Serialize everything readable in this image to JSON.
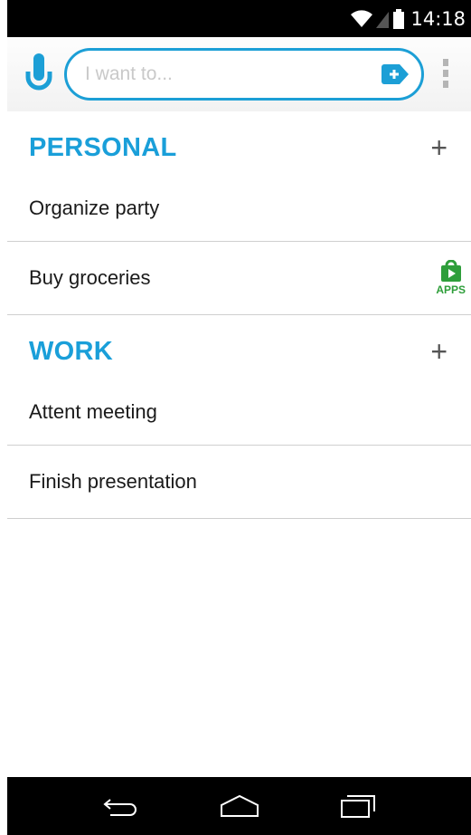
{
  "status_bar": {
    "time": "14:18"
  },
  "header": {
    "search_placeholder": "I want to...",
    "accent_color": "#1c9fd6",
    "icons": {
      "mic": "mic-icon",
      "add_tag": "add-tag-icon",
      "overflow": "overflow-menu-icon"
    }
  },
  "sections": [
    {
      "title": "PERSONAL",
      "add_label": "+",
      "tasks": [
        {
          "label": "Organize party"
        },
        {
          "label": "Buy groceries",
          "badge": "APPS"
        }
      ]
    },
    {
      "title": "WORK",
      "add_label": "+",
      "tasks": [
        {
          "label": "Attent meeting"
        },
        {
          "label": "Finish presentation"
        }
      ]
    }
  ],
  "nav_bar": {
    "icons": [
      "back-icon",
      "home-icon",
      "recents-icon"
    ]
  },
  "colors": {
    "section_title": "#1a9fd9",
    "apps_green": "#2e9e3a"
  }
}
